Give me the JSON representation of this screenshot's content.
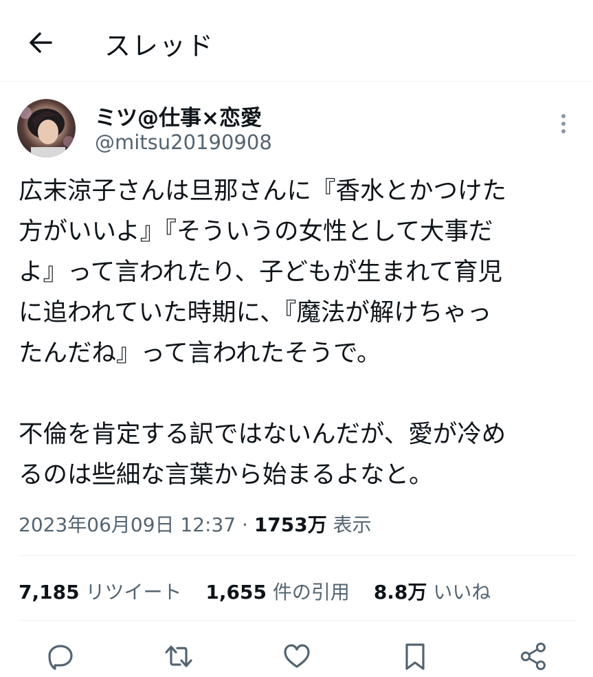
{
  "header": {
    "title": "スレッド",
    "back_icon": "arrow-left-icon"
  },
  "tweet": {
    "display_name": "ミツ@仕事×恋愛",
    "handle": "@mitsu20190908",
    "text": "広末涼子さんは旦那さんに『香水とかつけた\n方がいいよ』『そういうの女性として大事だ\nよ』って言われたり、子どもが生まれて育児\nに追われていた時期に、『魔法が解けちゃっ\nたんだね』って言われたそうで。\n\n不倫を肯定する訳ではないんだが、愛が冷め\nるのは些細な言葉から始まるよなと。",
    "timestamp": "2023年06月09日 12:37",
    "separator": "·",
    "views_count": "1753万",
    "views_label": "表示"
  },
  "stats": {
    "retweets_count": "7,185",
    "retweets_label": "リツイート",
    "quotes_count": "1,655",
    "quotes_label": "件の引用",
    "likes_count": "8.8万",
    "likes_label": "いいね"
  },
  "actions": [
    "reply-icon",
    "retweet-icon",
    "like-icon",
    "bookmark-icon",
    "share-icon"
  ],
  "colors": {
    "text": "#0f1419",
    "secondary": "#536471",
    "divider": "#eff3f4"
  }
}
